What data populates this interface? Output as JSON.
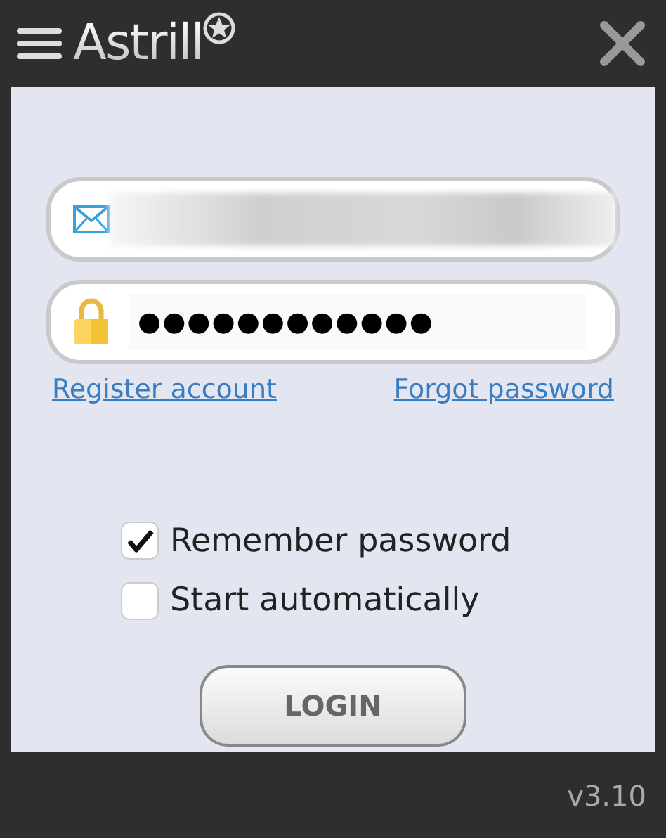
{
  "header": {
    "title": "Astrill"
  },
  "email_field": {
    "kind": "blurred"
  },
  "password_field": {
    "value": "●●●●●●●●●●●●"
  },
  "links": [
    {
      "label": "Register account"
    },
    {
      "label": "Forgot password"
    }
  ],
  "options": [
    {
      "label": "Remember password",
      "checked": true
    },
    {
      "label": "Start automatically",
      "checked": false
    }
  ],
  "login_button": {
    "label": "LOGIN"
  },
  "footer": {
    "version": "v3.10"
  }
}
